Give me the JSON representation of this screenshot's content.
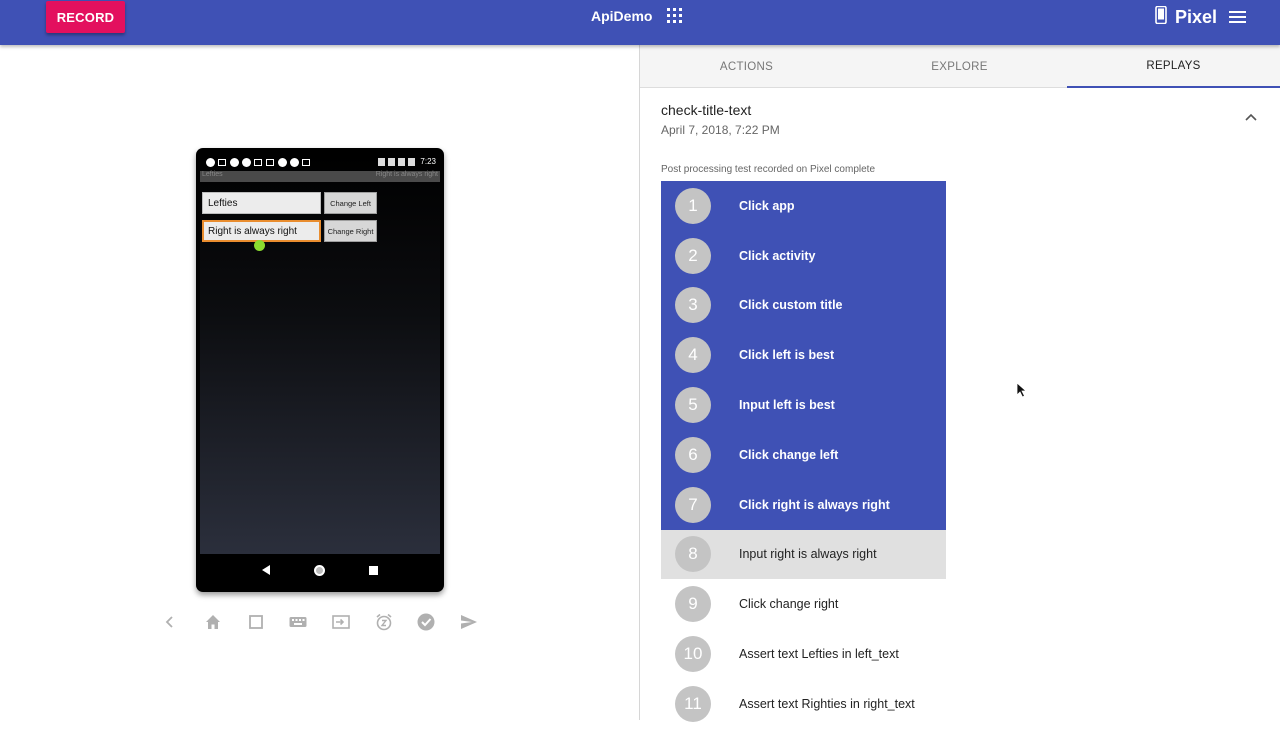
{
  "header": {
    "record_label": "RECORD",
    "app_name": "ApiDemo",
    "device_name": "Pixel",
    "accent_color": "#3f51b5",
    "record_color": "#e3105e"
  },
  "phone": {
    "status_time": "7:23",
    "title_left": "Lefties",
    "title_right": "Right is always right",
    "left_field_value": "Lefties",
    "right_field_value": "Right is always right",
    "change_left_label": "Change Left",
    "change_right_label": "Change Right"
  },
  "device_toolbar": {
    "icons": [
      "chevron-left-icon",
      "home-icon",
      "square-icon",
      "keyboard-icon",
      "input-icon",
      "alarm-icon",
      "check-circle-icon",
      "send-icon"
    ]
  },
  "tabs": [
    {
      "label": "ACTIONS"
    },
    {
      "label": "EXPLORE"
    },
    {
      "label": "REPLAYS"
    }
  ],
  "replay": {
    "name": "check-title-text",
    "date": "April 7, 2018, 7:22 PM",
    "note": "Post processing test recorded on Pixel complete",
    "steps": [
      {
        "num": "1",
        "label": "Click app",
        "state": "done"
      },
      {
        "num": "2",
        "label": "Click activity",
        "state": "done"
      },
      {
        "num": "3",
        "label": "Click custom title",
        "state": "done"
      },
      {
        "num": "4",
        "label": "Click left is best",
        "state": "done"
      },
      {
        "num": "5",
        "label": "Input left is best",
        "state": "done"
      },
      {
        "num": "6",
        "label": "Click change left",
        "state": "done"
      },
      {
        "num": "7",
        "label": "Click right is always right",
        "state": "done"
      },
      {
        "num": "8",
        "label": "Input right is always right",
        "state": "current"
      },
      {
        "num": "9",
        "label": "Click change right",
        "state": "pending"
      },
      {
        "num": "10",
        "label": "Assert text Lefties in left_text",
        "state": "pending"
      },
      {
        "num": "11",
        "label": "Assert text Righties in right_text",
        "state": "pending"
      }
    ]
  }
}
